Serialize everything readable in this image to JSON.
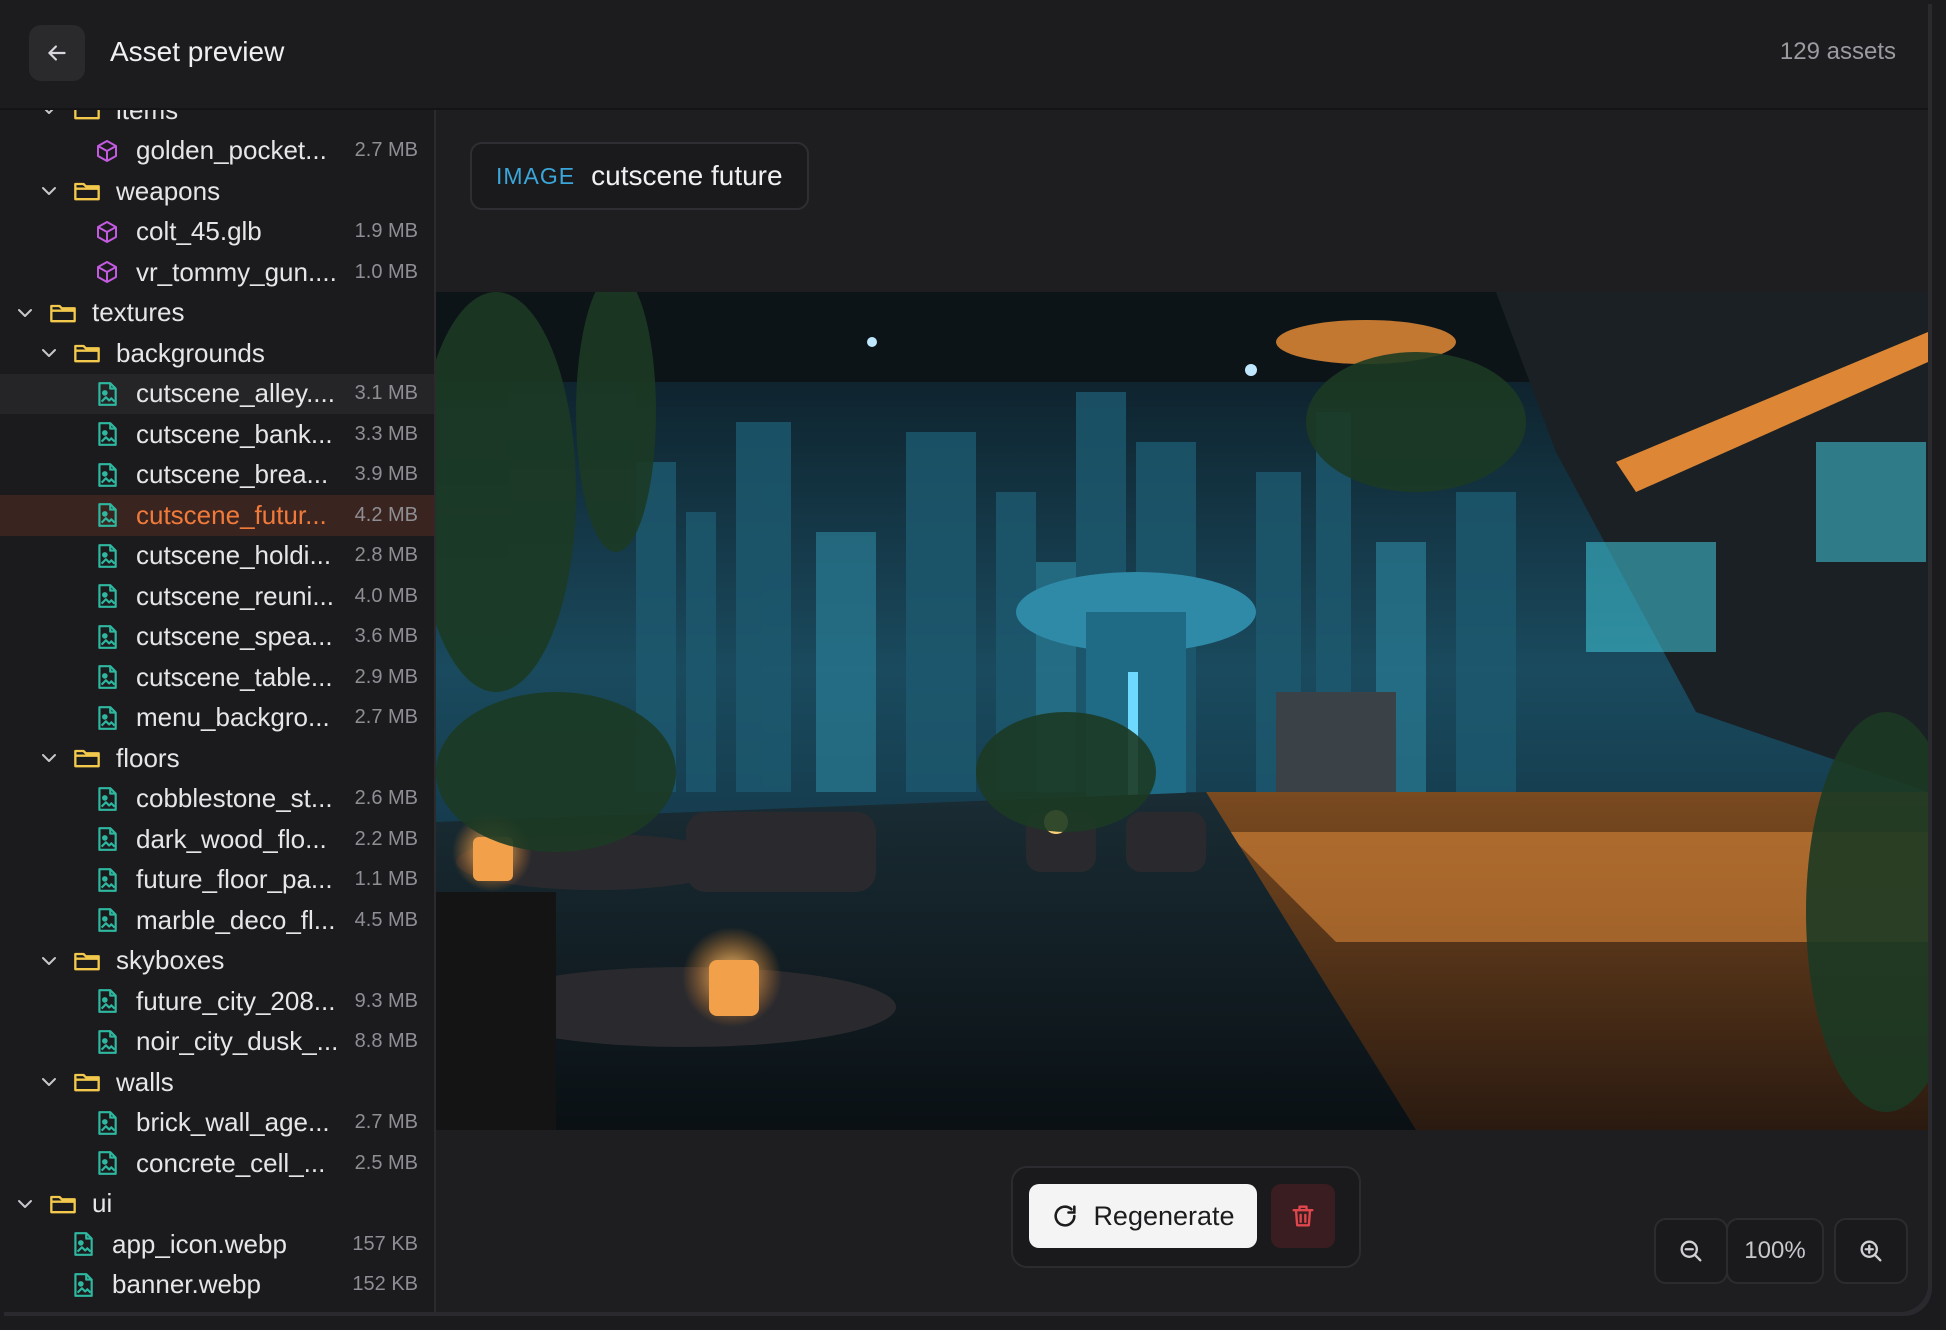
{
  "header": {
    "title": "Asset preview",
    "count": "129 assets"
  },
  "tree": [
    {
      "kind": "folder",
      "depth": 1,
      "name": "items"
    },
    {
      "kind": "model",
      "depth": 2,
      "name": "golden_pocket...",
      "size": "2.7 MB"
    },
    {
      "kind": "folder",
      "depth": 1,
      "name": "weapons"
    },
    {
      "kind": "model",
      "depth": 2,
      "name": "colt_45.glb",
      "size": "1.9 MB"
    },
    {
      "kind": "model",
      "depth": 2,
      "name": "vr_tommy_gun....",
      "size": "1.0 MB"
    },
    {
      "kind": "folder",
      "depth": 0,
      "name": "textures"
    },
    {
      "kind": "folder",
      "depth": 1,
      "name": "backgrounds"
    },
    {
      "kind": "image",
      "depth": 2,
      "name": "cutscene_alley....",
      "size": "3.1 MB",
      "state": "hover"
    },
    {
      "kind": "image",
      "depth": 2,
      "name": "cutscene_bank...",
      "size": "3.3 MB"
    },
    {
      "kind": "image",
      "depth": 2,
      "name": "cutscene_brea...",
      "size": "3.9 MB"
    },
    {
      "kind": "image",
      "depth": 2,
      "name": "cutscene_futur...",
      "size": "4.2 MB",
      "state": "selected"
    },
    {
      "kind": "image",
      "depth": 2,
      "name": "cutscene_holdi...",
      "size": "2.8 MB"
    },
    {
      "kind": "image",
      "depth": 2,
      "name": "cutscene_reuni...",
      "size": "4.0 MB"
    },
    {
      "kind": "image",
      "depth": 2,
      "name": "cutscene_spea...",
      "size": "3.6 MB"
    },
    {
      "kind": "image",
      "depth": 2,
      "name": "cutscene_table...",
      "size": "2.9 MB"
    },
    {
      "kind": "image",
      "depth": 2,
      "name": "menu_backgro...",
      "size": "2.7 MB"
    },
    {
      "kind": "folder",
      "depth": 1,
      "name": "floors"
    },
    {
      "kind": "image",
      "depth": 2,
      "name": "cobblestone_st...",
      "size": "2.6 MB"
    },
    {
      "kind": "image",
      "depth": 2,
      "name": "dark_wood_flo...",
      "size": "2.2 MB"
    },
    {
      "kind": "image",
      "depth": 2,
      "name": "future_floor_pa...",
      "size": "1.1 MB"
    },
    {
      "kind": "image",
      "depth": 2,
      "name": "marble_deco_fl...",
      "size": "4.5 MB"
    },
    {
      "kind": "folder",
      "depth": 1,
      "name": "skyboxes"
    },
    {
      "kind": "image",
      "depth": 2,
      "name": "future_city_208...",
      "size": "9.3 MB"
    },
    {
      "kind": "image",
      "depth": 2,
      "name": "noir_city_dusk_...",
      "size": "8.8 MB"
    },
    {
      "kind": "folder",
      "depth": 1,
      "name": "walls"
    },
    {
      "kind": "image",
      "depth": 2,
      "name": "brick_wall_age...",
      "size": "2.7 MB"
    },
    {
      "kind": "image",
      "depth": 2,
      "name": "concrete_cell_...",
      "size": "2.5 MB"
    },
    {
      "kind": "folder",
      "depth": 0,
      "name": "ui"
    },
    {
      "kind": "image",
      "depth": 1,
      "name": "app_icon.webp",
      "size": "157 KB"
    },
    {
      "kind": "image",
      "depth": 1,
      "name": "banner.webp",
      "size": "152 KB"
    }
  ],
  "preview": {
    "type_tag": "IMAGE",
    "asset_name": "cutscene future"
  },
  "actions": {
    "regenerate_label": "Regenerate"
  },
  "zoom": {
    "level": "100%"
  },
  "colors": {
    "accent_selected": "#f07a3a",
    "type_tag": "#3aa6d9",
    "folder": "#f2c94c",
    "model_icon": "#c35be0",
    "image_icon": "#2fb8a0",
    "delete": "#e0474c"
  },
  "icons": {
    "back": "arrow-left-icon",
    "folder": "folder-open-icon",
    "model": "cube-icon",
    "image": "image-file-icon",
    "regenerate": "refresh-icon",
    "delete": "trash-icon",
    "zoom_out": "zoom-out-icon",
    "zoom_in": "zoom-in-icon"
  }
}
